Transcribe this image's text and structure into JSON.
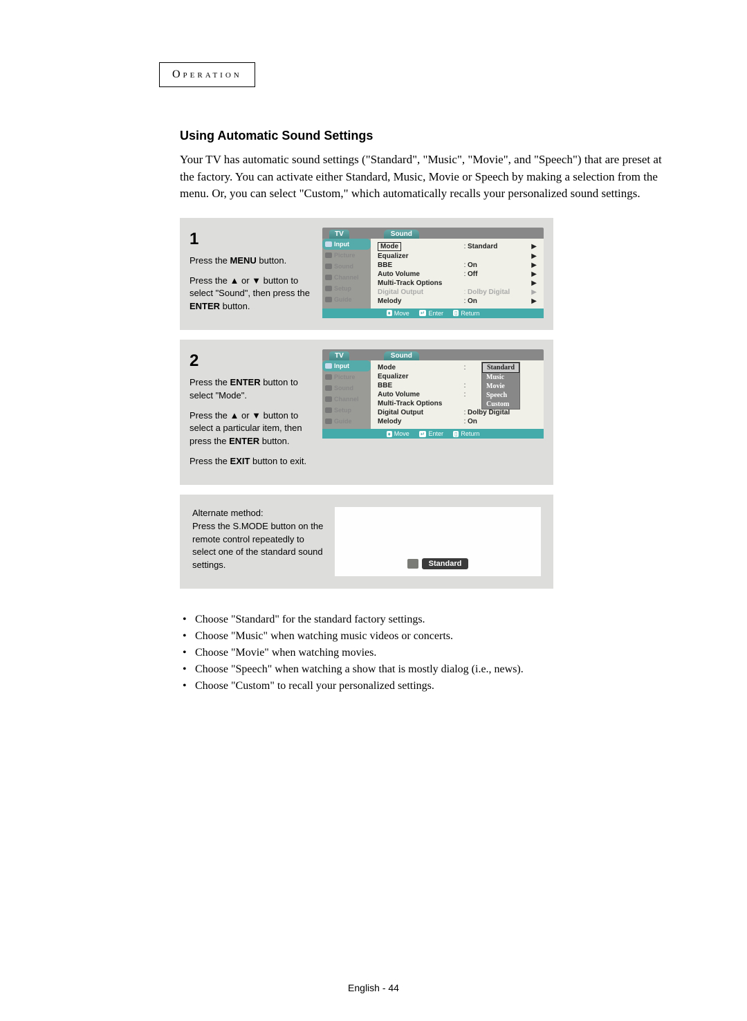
{
  "header": "Operation",
  "section_title": "Using Automatic Sound Settings",
  "intro": "Your TV has automatic sound settings (\"Standard\", \"Music\", \"Movie\", and \"Speech\")  that are preset at the factory.  You can activate either Standard, Music, Movie or Speech by making a selection from the menu. Or, you can select \"Custom,\" which automatically recalls your personalized sound settings.",
  "step1": {
    "num": "1",
    "p1a": "Press the ",
    "p1b": "MENU",
    "p1c": " button.",
    "p2a": "Press the ▲ or ▼ button to select \"Sound\", then press the ",
    "p2b": "ENTER",
    "p2c": " button."
  },
  "step2": {
    "num": "2",
    "p1a": "Press the ",
    "p1b": "ENTER",
    "p1c": " button to select \"Mode\".",
    "p2a": "Press the ▲ or ▼ button to select a particular item, then press the ",
    "p2b": "ENTER",
    "p2c": " button.",
    "p3a": "Press the ",
    "p3b": "EXIT",
    "p3c": " button to exit."
  },
  "osd": {
    "tv": "TV",
    "title": "Sound",
    "sidebar": [
      "Input",
      "Picture",
      "Sound",
      "Channel",
      "Setup",
      "Guide"
    ],
    "rows": {
      "mode": "Mode",
      "equalizer": "Equalizer",
      "bbe": "BBE",
      "auto_volume": "Auto Volume",
      "multi_track": "Multi-Track Options",
      "digital_output": "Digital Output",
      "melody": "Melody"
    },
    "vals": {
      "standard": "Standard",
      "on": "On",
      "off": "Off",
      "dolby": "Dolby Digital"
    },
    "footer": {
      "move": "Move",
      "enter": "Enter",
      "return": "Return"
    }
  },
  "dropdown": [
    "Standard",
    "Music",
    "Movie",
    "Speech",
    "Custom"
  ],
  "alt": {
    "title": "Alternate method:",
    "p1a": "Press the ",
    "p1b": "S.MODE",
    "p1c": " button on the remote control repeatedly to select one of the standard sound settings.",
    "pill": "Standard"
  },
  "bullets": [
    "Choose \"Standard\" for the standard factory settings.",
    "Choose \"Music\" when watching music videos or concerts.",
    "Choose \"Movie\" when watching movies.",
    "Choose \"Speech\" when watching a show that is mostly dialog (i.e., news).",
    "Choose \"Custom\" to recall your personalized settings."
  ],
  "page": "English - 44"
}
